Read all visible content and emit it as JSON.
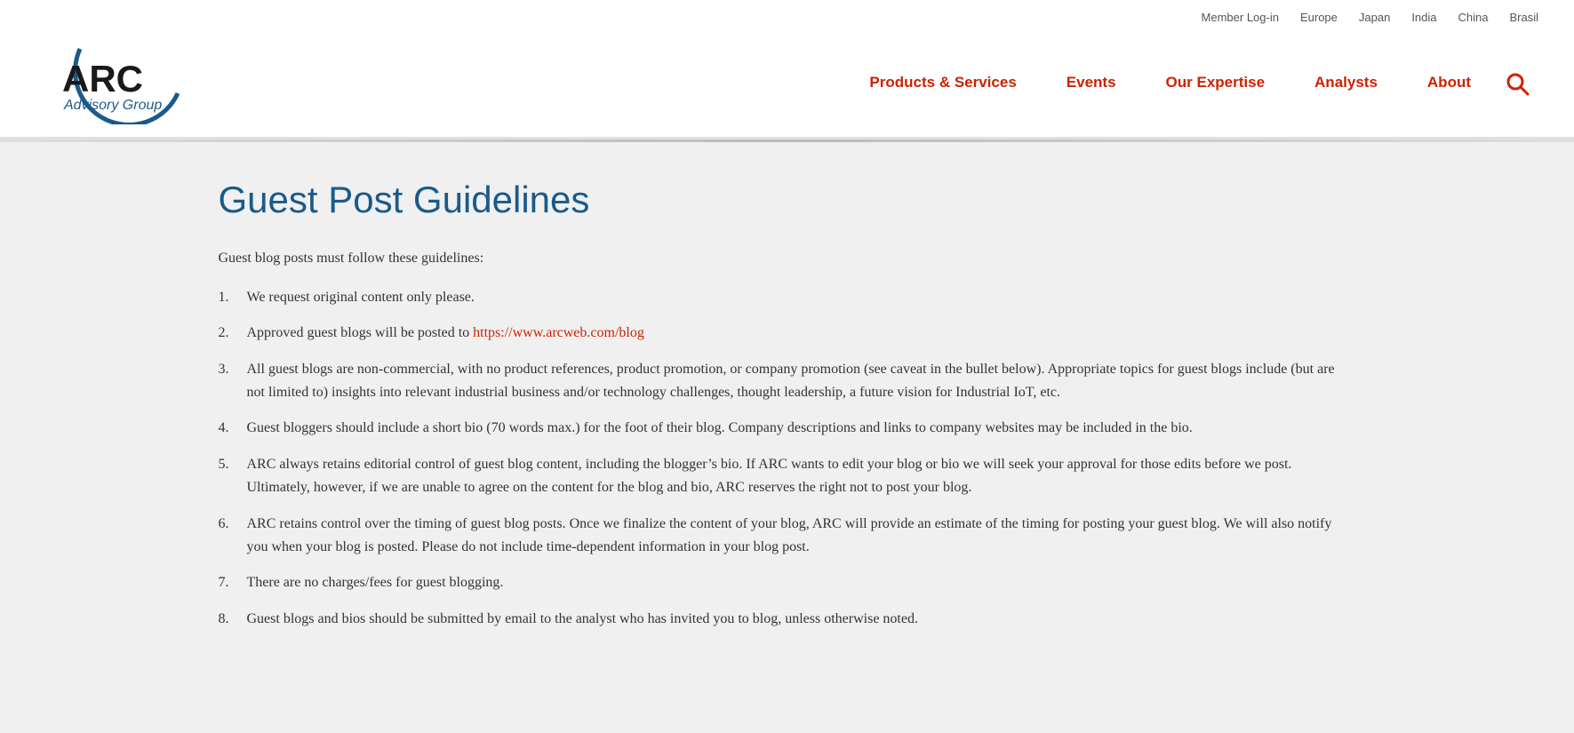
{
  "topbar": {
    "links": [
      {
        "label": "Member Log-in",
        "name": "member-login-link"
      },
      {
        "label": "Europe",
        "name": "europe-link"
      },
      {
        "label": "Japan",
        "name": "japan-link"
      },
      {
        "label": "India",
        "name": "india-link"
      },
      {
        "label": "China",
        "name": "china-link"
      },
      {
        "label": "Brasil",
        "name": "brasil-link"
      }
    ]
  },
  "nav": {
    "items": [
      {
        "label": "Products & Services",
        "name": "nav-products-services"
      },
      {
        "label": "Events",
        "name": "nav-events"
      },
      {
        "label": "Our Expertise",
        "name": "nav-our-expertise"
      },
      {
        "label": "Analysts",
        "name": "nav-analysts"
      },
      {
        "label": "About",
        "name": "nav-about"
      }
    ]
  },
  "logo": {
    "arc_text": "ARC",
    "advisory_text": "Advisory Group"
  },
  "page": {
    "title": "Guest Post Guidelines",
    "intro": "Guest blog posts must follow these guidelines:",
    "guidelines": [
      {
        "text": "We request original content only please.",
        "link": null,
        "link_text": null
      },
      {
        "text_before": "Approved guest blogs will be posted to ",
        "link": "https://www.arcweb.com/blog",
        "link_text": "https://www.arcweb.com/blog",
        "text_after": ""
      },
      {
        "text": "All guest blogs are non-commercial, with no product references, product promotion, or company promotion (see caveat in the bullet below). Appropriate topics for guest blogs include (but are not limited to) insights into relevant industrial business and/or technology challenges, thought leadership, a future vision for Industrial IoT, etc.",
        "link": null
      },
      {
        "text": "Guest bloggers should include a short bio (70 words max.) for the foot of their blog.  Company descriptions and links to company websites may be included in the bio.",
        "link": null
      },
      {
        "text": "ARC always retains editorial control of guest blog content, including the blogger’s bio.  If ARC wants to edit your blog or bio we will seek your approval for those edits before we post.  Ultimately, however, if we are unable to agree on the content for the blog and bio, ARC reserves the right not to post your blog.",
        "link": null
      },
      {
        "text": "ARC retains control over the timing of guest blog posts.  Once we finalize the content of your blog, ARC will provide an estimate of the timing for posting your guest blog.  We will also notify you when your blog is posted.  Please do not include time-dependent information in your blog post.",
        "link": null
      },
      {
        "text": "There are no charges/fees for guest blogging.",
        "link": null
      },
      {
        "text": "Guest blogs and bios should be submitted by email to the analyst who has invited you to blog, unless otherwise noted.",
        "link": null
      }
    ]
  }
}
